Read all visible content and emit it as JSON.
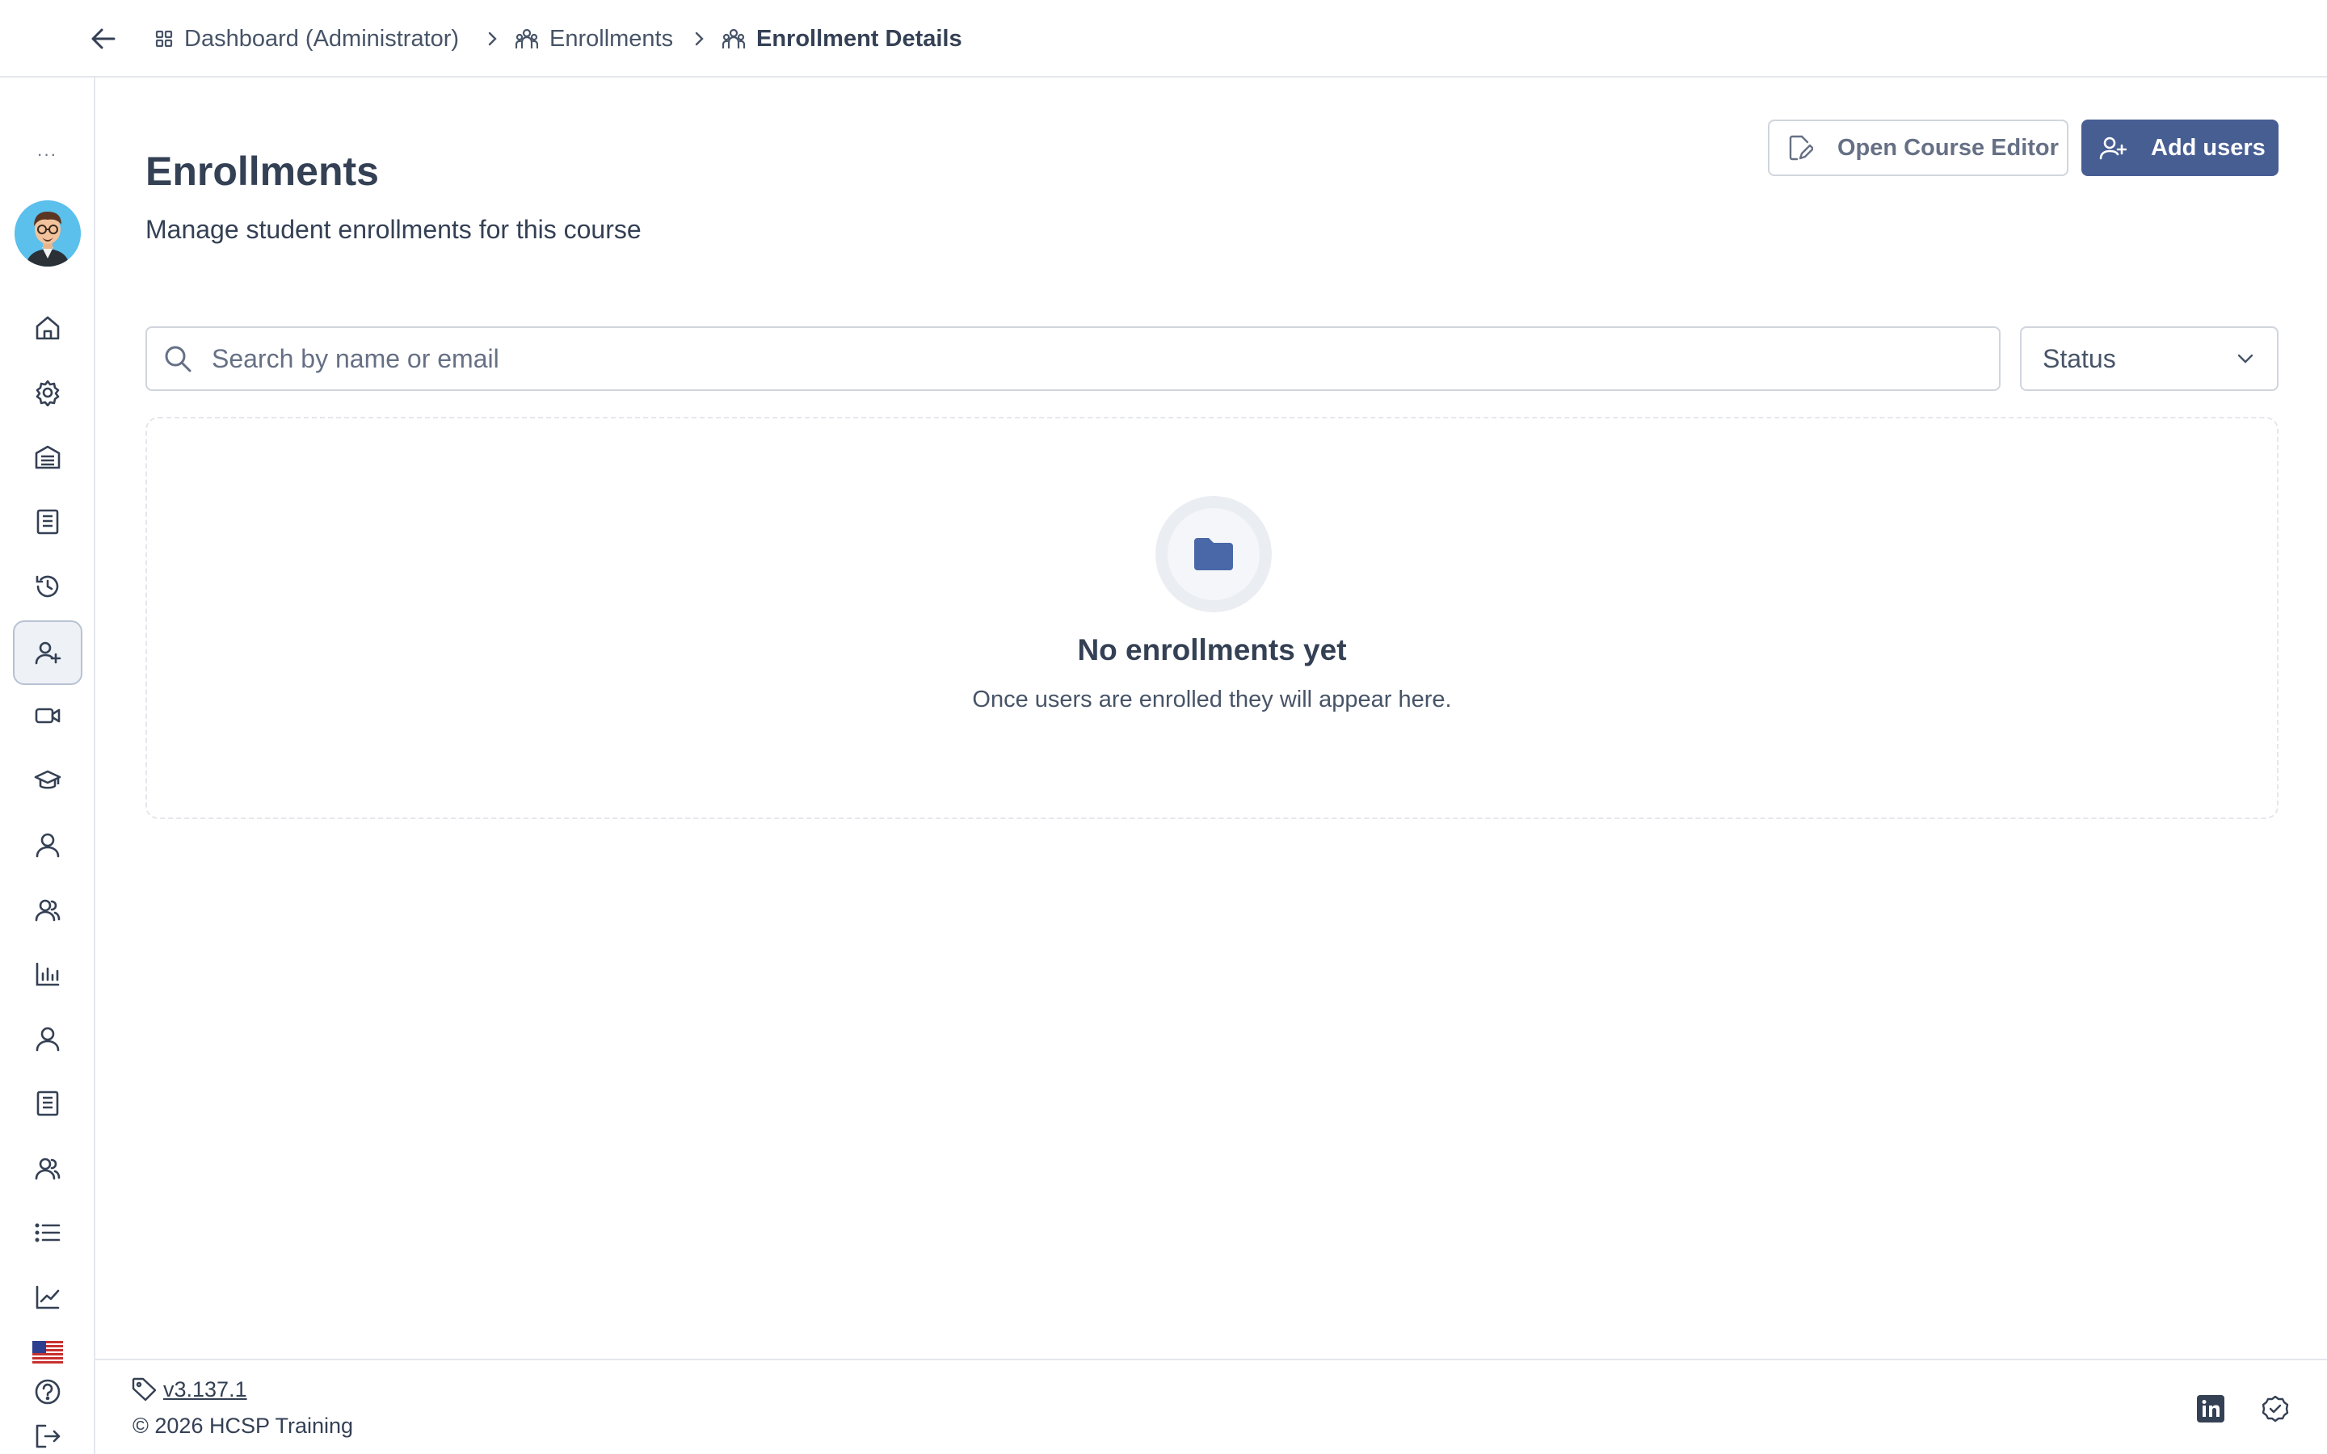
{
  "breadcrumb": {
    "items": [
      {
        "label": "Dashboard (Administrator)",
        "icon": "grid-icon"
      },
      {
        "label": "Enrollments",
        "icon": "users-group-icon"
      },
      {
        "label": "Enrollment Details",
        "icon": "users-group-icon"
      }
    ]
  },
  "sidebar": {
    "more": "···",
    "items": [
      {
        "icon": "home-icon",
        "active": false
      },
      {
        "icon": "gear-icon",
        "active": false
      },
      {
        "icon": "building-icon",
        "active": false
      },
      {
        "icon": "document-icon",
        "active": false
      },
      {
        "icon": "history-icon",
        "active": false
      },
      {
        "icon": "user-plus-icon",
        "active": true
      },
      {
        "icon": "video-icon",
        "active": false
      },
      {
        "icon": "graduation-cap-icon",
        "active": false
      },
      {
        "icon": "user-icon",
        "active": false
      },
      {
        "icon": "users-icon",
        "active": false
      },
      {
        "icon": "bar-chart-icon",
        "active": false
      },
      {
        "icon": "user-icon",
        "active": false
      },
      {
        "icon": "document-icon",
        "active": false
      },
      {
        "icon": "users-icon",
        "active": false
      },
      {
        "icon": "list-icon",
        "active": false
      },
      {
        "icon": "trend-chart-icon",
        "active": false
      },
      {
        "icon": "help-icon",
        "active": false
      },
      {
        "icon": "logout-icon",
        "active": false
      }
    ]
  },
  "header": {
    "title": "Enrollments",
    "subtitle": "Manage student enrollments for this course"
  },
  "actions": {
    "open_editor": "Open Course Editor",
    "add_users": "Add users"
  },
  "filters": {
    "search_placeholder": "Search by name or email",
    "status_label": "Status"
  },
  "empty_state": {
    "title": "No enrollments yet",
    "text": "Once users are enrolled they will appear here."
  },
  "footer": {
    "version": "v3.137.1",
    "copyright": "© 2026 HCSP Training"
  },
  "colors": {
    "primary": "#475e93",
    "folder": "#4a67a8",
    "text": "#344054",
    "border": "#d0d5dd"
  }
}
